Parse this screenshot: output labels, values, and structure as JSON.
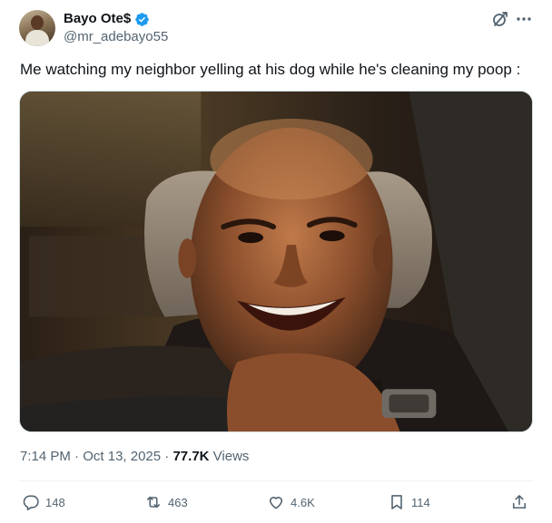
{
  "author": {
    "display_name": "Bayo Ote$",
    "handle": "@mr_adebayo55",
    "verified": true,
    "verified_color": "#1d9bf0"
  },
  "header_icons": {
    "grok": "grok-icon",
    "more": "more-icon"
  },
  "tweet": {
    "text": "Me watching my neighbor yelling at his dog while he's cleaning my poop :"
  },
  "meta": {
    "time": "7:14 PM",
    "separator_1": " · ",
    "date": "Oct 13, 2025",
    "separator_2": " · ",
    "views_count": "77.7K",
    "views_label": " Views"
  },
  "actions": {
    "reply_count": "148",
    "repost_count": "463",
    "like_count": "4.6K",
    "bookmark_count": "114",
    "reply_icon": "reply-icon",
    "repost_icon": "repost-icon",
    "like_icon": "heart-icon",
    "bookmark_icon": "bookmark-icon",
    "share_icon": "share-icon"
  },
  "colors": {
    "text_primary": "#0f1419",
    "text_secondary": "#536471",
    "accent": "#1d9bf0",
    "border": "#cfd9de"
  }
}
